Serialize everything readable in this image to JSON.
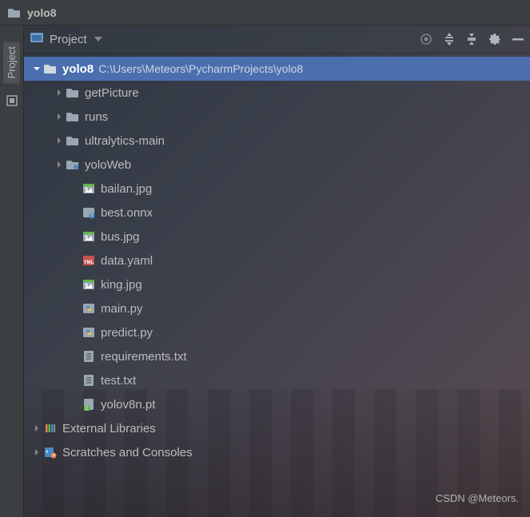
{
  "titlebar": {
    "project_name": "yolo8"
  },
  "sidebar": {
    "tab_label": "Project"
  },
  "panel": {
    "title": "Project",
    "actions": {
      "target": "target",
      "collapse": "collapse-all",
      "expand": "expand-all",
      "settings": "settings",
      "hide": "hide"
    }
  },
  "tree": {
    "root": {
      "name": "yolo8",
      "path": "C:\\Users\\Meteors\\PycharmProjects\\yolo8",
      "expanded": true,
      "children": [
        {
          "name": "getPicture",
          "type": "folder",
          "expanded": false
        },
        {
          "name": "runs",
          "type": "folder",
          "expanded": false
        },
        {
          "name": "ultralytics-main",
          "type": "folder",
          "expanded": false
        },
        {
          "name": "yoloWeb",
          "type": "folder-src",
          "expanded": false
        },
        {
          "name": "bailan.jpg",
          "type": "image"
        },
        {
          "name": "best.onnx",
          "type": "onnx"
        },
        {
          "name": "bus.jpg",
          "type": "image"
        },
        {
          "name": "data.yaml",
          "type": "yaml"
        },
        {
          "name": "king.jpg",
          "type": "image"
        },
        {
          "name": "main.py",
          "type": "python"
        },
        {
          "name": "predict.py",
          "type": "python"
        },
        {
          "name": "requirements.txt",
          "type": "text"
        },
        {
          "name": "test.txt",
          "type": "text"
        },
        {
          "name": "yolov8n.pt",
          "type": "pt"
        }
      ]
    },
    "extras": [
      {
        "name": "External Libraries",
        "icon": "libraries",
        "expanded": false
      },
      {
        "name": "Scratches and Consoles",
        "icon": "scratches",
        "expanded": false
      }
    ]
  },
  "watermark": "CSDN @Meteors."
}
